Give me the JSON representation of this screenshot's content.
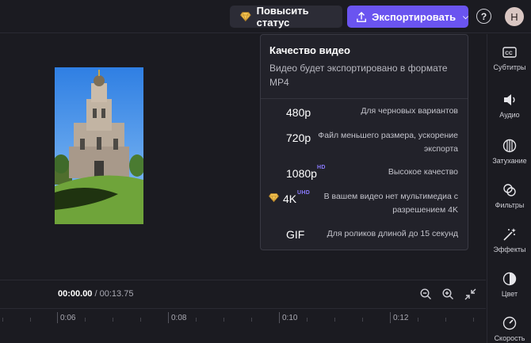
{
  "header": {
    "upgrade_label": "Повысить статус",
    "export_label": "Экспортировать",
    "help": "?",
    "avatar_initial": "Н"
  },
  "player": {
    "current_time": "00:00.00",
    "total_time": "/ 00:13.75"
  },
  "timeline": {
    "ticks": [
      "0:06",
      "0:08",
      "0:10",
      "0:12"
    ]
  },
  "sidebar": {
    "items": [
      {
        "label": "Субтитры",
        "icon": "captions-icon"
      },
      {
        "label": "Аудио",
        "icon": "speaker-icon"
      },
      {
        "label": "Затухание",
        "icon": "fade-icon"
      },
      {
        "label": "Фильтры",
        "icon": "filters-icon"
      },
      {
        "label": "Эффекты",
        "icon": "magic-wand-icon"
      },
      {
        "label": "Цвет",
        "icon": "color-icon"
      },
      {
        "label": "Скорость",
        "icon": "speedometer-icon"
      }
    ]
  },
  "export_popup": {
    "title": "Качество видео",
    "subtitle": "Видео будет экспортировано в формате MP4",
    "options": [
      {
        "resolution": "480p",
        "badge": "",
        "description": "Для черновых вариантов"
      },
      {
        "resolution": "720p",
        "badge": "",
        "description": "Файл меньшего размера, ускорение экспорта"
      },
      {
        "resolution": "1080p",
        "badge": "HD",
        "description": "Высокое качество"
      },
      {
        "resolution": "4K",
        "badge": "UHD",
        "description": "В вашем видео нет мультимедиа с разрешением 4K"
      },
      {
        "resolution": "GIF",
        "badge": "",
        "description": "Для роликов длиной до 15 секунд"
      }
    ]
  },
  "colors": {
    "accent": "#6a54f0",
    "badge": "#8b7bff",
    "premium_gem": "#f2c14e",
    "background": "#1b1b21"
  }
}
